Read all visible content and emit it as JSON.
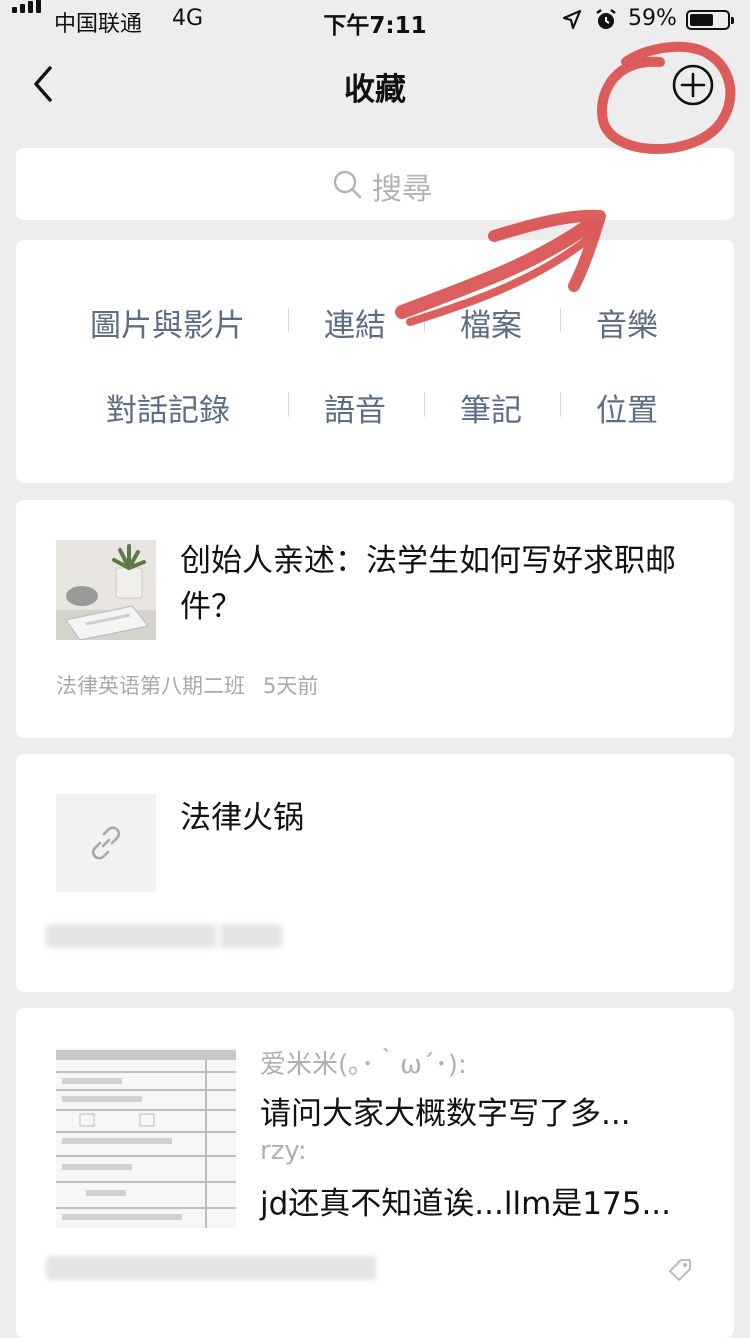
{
  "status_bar": {
    "carrier": "中国联通",
    "network": "4G",
    "time": "下午7:11",
    "battery": "59%",
    "battery_level": 0.59,
    "icons": [
      "signal-icon",
      "location-icon",
      "alarm-icon",
      "battery-icon"
    ]
  },
  "nav": {
    "title": "收藏",
    "back_icon": "chevron-left-icon",
    "add_icon": "plus-circle-icon"
  },
  "search": {
    "placeholder": "搜尋",
    "icon": "search-icon"
  },
  "categories": {
    "row1": [
      "圖片與影片",
      "連結",
      "檔案",
      "音樂"
    ],
    "row2": [
      "對話記錄",
      "語音",
      "筆記",
      "位置"
    ]
  },
  "items": [
    {
      "title": "创始人亲述：法学生如何写好求职邮件？",
      "source": "法律英语第八期二班",
      "time": "5天前"
    },
    {
      "title": "法律火锅",
      "icon": "link-icon"
    },
    {
      "user1": "爱米米(｡･｀ω´･):",
      "line1": "请问大家大概数字写了多...",
      "user2": "rzy:",
      "line2": "jd还真不知道诶...llm是175...",
      "icon": "tag-icon"
    }
  ],
  "colors": {
    "background": "#ededed",
    "category_text": "#5e6d86",
    "annotation": "#d94848"
  }
}
